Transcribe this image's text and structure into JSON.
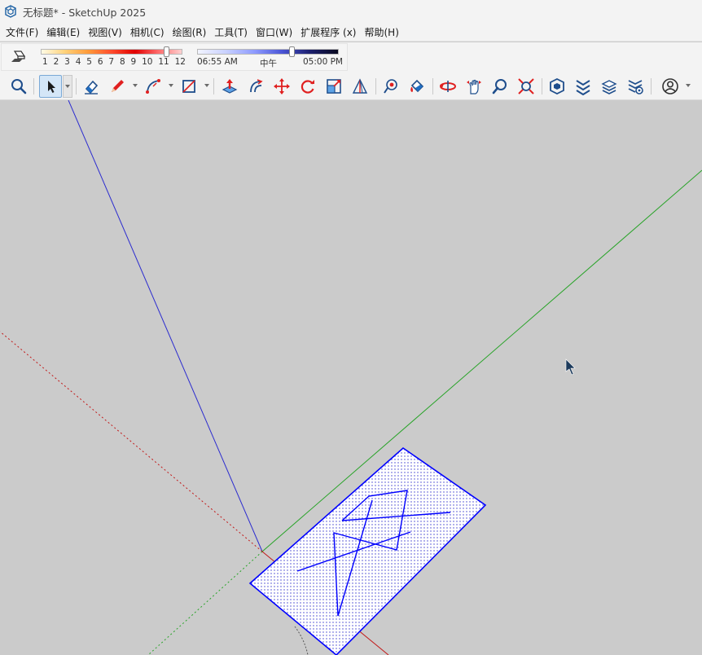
{
  "window": {
    "title": "无标题* - SketchUp 2025"
  },
  "menu": [
    {
      "id": "file",
      "label": "文件(F)"
    },
    {
      "id": "edit",
      "label": "编辑(E)"
    },
    {
      "id": "view",
      "label": "视图(V)"
    },
    {
      "id": "camera",
      "label": "相机(C)"
    },
    {
      "id": "draw",
      "label": "绘图(R)"
    },
    {
      "id": "tools",
      "label": "工具(T)"
    },
    {
      "id": "window",
      "label": "窗口(W)"
    },
    {
      "id": "extensions",
      "label": "扩展程序 (x)"
    },
    {
      "id": "help",
      "label": "帮助(H)"
    }
  ],
  "shadows": {
    "months": [
      "1",
      "2",
      "3",
      "4",
      "5",
      "6",
      "7",
      "8",
      "9",
      "10",
      "11",
      "12"
    ],
    "month_value": 11,
    "time_start": "06:55 AM",
    "time_mid": "中午",
    "time_end": "05:00 PM",
    "time_fraction": 0.68
  },
  "toolbar": {
    "tools": [
      {
        "name": "zoom-window-tool-button",
        "icon": "magnifier-icon"
      },
      {
        "name": "select-tool-button",
        "icon": "arrow-cursor-icon",
        "active": true
      },
      {
        "name": "eraser-tool-button",
        "icon": "eraser-icon"
      },
      {
        "name": "pencil-tool-button",
        "icon": "pencil-icon"
      },
      {
        "name": "arc-tool-button",
        "icon": "arc-icon"
      },
      {
        "name": "rectangle-tool-button",
        "icon": "rectangle-icon"
      },
      {
        "name": "push-pull-tool-button",
        "icon": "push-pull-icon"
      },
      {
        "name": "offset-tool-button",
        "icon": "offset-icon"
      },
      {
        "name": "move-tool-button",
        "icon": "move-icon"
      },
      {
        "name": "rotate-tool-button",
        "icon": "rotate-icon"
      },
      {
        "name": "scale-tool-button",
        "icon": "scale-icon"
      },
      {
        "name": "follow-me-tool-button",
        "icon": "follow-me-icon"
      },
      {
        "name": "tape-measure-tool-button",
        "icon": "tape-measure-icon"
      },
      {
        "name": "paint-bucket-tool-button",
        "icon": "paint-bucket-icon"
      },
      {
        "name": "orbit-tool-button",
        "icon": "orbit-icon"
      },
      {
        "name": "pan-tool-button",
        "icon": "pan-hand-icon"
      },
      {
        "name": "zoom-tool-button",
        "icon": "zoom-icon"
      },
      {
        "name": "zoom-extents-tool-button",
        "icon": "zoom-extents-icon"
      },
      {
        "name": "warehouse-button",
        "icon": "3d-warehouse-icon"
      },
      {
        "name": "extension-warehouse-button",
        "icon": "extension-warehouse-icon"
      },
      {
        "name": "send-to-layout-button",
        "icon": "layout-icon"
      },
      {
        "name": "extension-manager-button",
        "icon": "extension-manager-icon"
      },
      {
        "name": "account-button",
        "icon": "user-account-icon"
      }
    ]
  },
  "colors": {
    "axis_red": "#c21818",
    "axis_green": "#27a327",
    "axis_blue": "#2b2bcf",
    "selection_blue": "#0000ff",
    "background": "#cbcbcb",
    "face_white": "#ffffff"
  }
}
